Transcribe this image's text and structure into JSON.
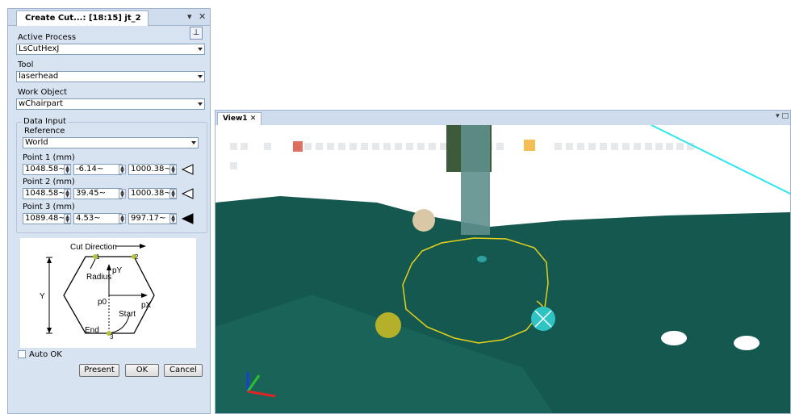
{
  "panel": {
    "tab_title": "Create Cut...: [18:15] jt_2",
    "tab_menu_glyph": "▾",
    "tab_close_glyph": "✕",
    "pin_glyph": "⊥",
    "fields": [
      {
        "label": "Active Process",
        "value": "LsCutHexJ"
      },
      {
        "label": "Tool",
        "value": "laserhead"
      },
      {
        "label": "Work Object",
        "value": "wChairpart"
      }
    ],
    "data_input": {
      "title": "Data Input",
      "reference_label": "Reference",
      "reference_value": "World",
      "points": [
        {
          "label": "Point 1 (mm)",
          "x": "1048.58~",
          "y": "-6.14~",
          "z": "1000.38~",
          "active": false
        },
        {
          "label": "Point 2 (mm)",
          "x": "1048.58~",
          "y": "39.45~",
          "z": "1000.38~",
          "active": false
        },
        {
          "label": "Point 3 (mm)",
          "x": "1089.48~",
          "y": "4.53~",
          "z": "997.17~",
          "active": true
        }
      ]
    },
    "diagram": {
      "cut_direction": "Cut Direction",
      "radius": "Radius",
      "py": "pY",
      "px": "pX",
      "p0": "p0",
      "y": "Y",
      "start": "Start",
      "end": "End",
      "markers": [
        "1",
        "2",
        "3"
      ]
    },
    "auto_ok_label": "Auto OK",
    "buttons": {
      "present": "Present",
      "ok": "OK",
      "cancel": "Cancel"
    }
  },
  "view": {
    "tab_title": "View1",
    "tab_close_glyph": "✕",
    "menu_glyph": "▾ □"
  },
  "colors": {
    "panel_bg": "#d8e3f1",
    "floor": "#14584f",
    "cut_path": "#e4d21a",
    "sphere_cyan": "#2fc3c3",
    "sphere_yellow": "#b4b02a",
    "guide_line": "#2ee6ee"
  }
}
